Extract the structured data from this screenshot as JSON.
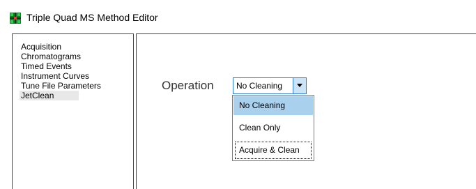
{
  "window": {
    "title": "Triple Quad MS Method Editor",
    "icon": "triple-quad-app-icon"
  },
  "nav": {
    "items": [
      {
        "label": "Acquisition",
        "selected": false
      },
      {
        "label": "Chromatograms",
        "selected": false
      },
      {
        "label": "Timed Events",
        "selected": false
      },
      {
        "label": "Instrument Curves",
        "selected": false
      },
      {
        "label": "Tune File Parameters",
        "selected": false
      },
      {
        "label": "JetClean",
        "selected": true
      }
    ]
  },
  "operation": {
    "label": "Operation",
    "selected_value": "No Cleaning",
    "options": [
      "No Cleaning",
      "Clean Only",
      "Acquire & Clean"
    ],
    "hovered_option": "No Cleaning",
    "focused_option": "Acquire & Clean"
  },
  "colors": {
    "combo_border": "#2f7fd1",
    "combo_button": "#cce4f7",
    "hover_highlight": "#a9d1ee",
    "selected_nav": "#e8e8e8"
  }
}
